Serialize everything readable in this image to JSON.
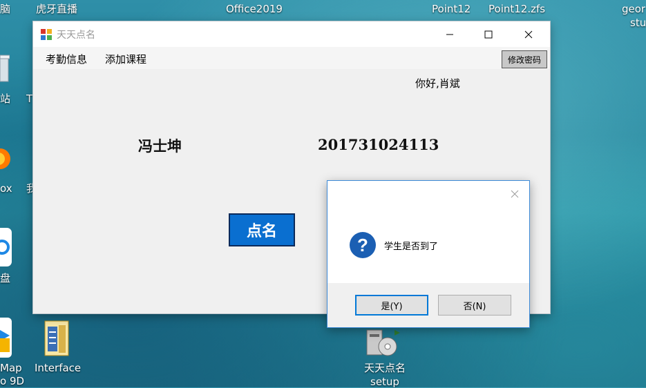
{
  "desktop": {
    "labels": {
      "top_left_partial": "脑",
      "huya": "虎牙直播",
      "office": "Office2019",
      "point12": "Point12",
      "point12_zfs": "Point12.zfs",
      "geo_partial_1": "geor",
      "geo_partial_2": "stu",
      "left_partial_station": "站",
      "left_partial_t": "T",
      "left_partial_ox": "ox",
      "left_partial_wo": "我",
      "left_partial_pan": "盘",
      "left_partial_map": "Map",
      "left_partial_9d": "o 9D",
      "interface": "Interface",
      "setup_line1": "天天点名",
      "setup_line2": "setup"
    }
  },
  "window": {
    "title": "天天点名",
    "menu": [
      "考勤信息",
      "添加课程"
    ],
    "change_password": "修改密码",
    "greeting": "你好,肖斌",
    "student_name": "冯士坤",
    "student_id": "201731024113",
    "rollcall_button": "点名"
  },
  "dialog": {
    "message": "学生是否到了",
    "question_icon": "?",
    "yes": "是(Y)",
    "no": "否(N)"
  }
}
